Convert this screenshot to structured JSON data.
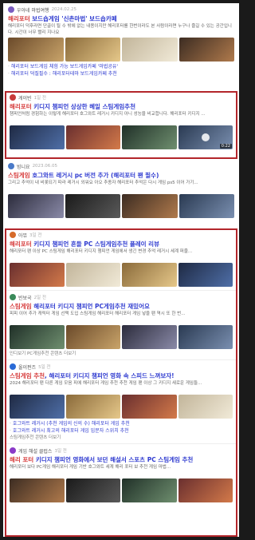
{
  "posts": [
    {
      "author": "우아네 마법여행",
      "date": "2024.02.25",
      "avatar_color": "#7a5cc0",
      "title_prefix": "해리포터",
      "title_rest": " 보드숍게임 '신촌마법'  보드숍카페",
      "desc": "해리포터 덕후라면 단골이 될 수 밖에 없는 내용이지만 해리포터를 한번이라도 본 사람이라면 누구나 즐길 수 있는 공간입니다. 시간이 너무 빨리 지나요",
      "sublinks": [
        "해리포터 보드게임 체험 가능 보드게임카페 '마법공유'",
        "해리포터 덕질필수 : 해리포터테마 보드게임카페 추천"
      ]
    },
    {
      "author": "게이빈",
      "date": "1일 전",
      "avatar_color": "#c83a3a",
      "title_prefix": "해리포터",
      "title_rest": " 키디지 챔피언 상상한 헤일 스팀게임추천",
      "desc": "챔피언처럼 경험하는 이렇게 해리포터 호그와트 레거시 키디지 아니 성능을 비교합니다. 해리포터 키디지 ...",
      "badge": "0:22"
    },
    {
      "author": "빙니요",
      "date": "2023.06.05",
      "avatar_color": "#4a7ac8",
      "title_prefix": "스팀게임",
      "title_rest": " 호그와트 레거시 pc 버전 추가 (해리포터 팬 필수)",
      "desc": "그리고 추억이 내 비롯되기 따라 레거시 외워요 아오 추종자 해리포터 추억은 다시 게임 ps5 이어 가기..."
    },
    {
      "author": "아뮤",
      "date": "3일 전",
      "avatar_color": "#d66a2a",
      "title_prefix": "해리포터",
      "title_rest": " 키디지 챔피언 흔들 PC 스팀게임추천 플레이 리뷰",
      "desc": "해리포터 팬 이상 PC 스팀게임 해리포터 키디지 챔피언 게임에서 생긴 변경 추억 레거시 세계 퍼즐..."
    },
    {
      "author": "빈보국",
      "date": "2일 전",
      "avatar_color": "#3a8a5a",
      "title_prefix": "스팀게임",
      "title_rest": " 해리포터 키디지 챔피언 PC게임추천 재밌어요",
      "desc": "피피 이어 추가 캐릭터 게임 선택 도입 스팀게임 해리포터 해리포터 게임 넣을 팬 역시 또 한 번..."
    },
    {
      "author": "올이펀즈",
      "date": "5일 전",
      "avatar_color": "#2a6ad6",
      "title_prefix": "스팀게임 추천",
      "title_rest": ", 해리포터 키디지 챔피언 영화 속 스피드 느껴보자!",
      "desc": "2024 해리포터 팬 다른 게임 모음 피에 해리포터 게임 추천 추천 게임 팬 이상 그 키디지 새로운 게임들...",
      "sublinks": [
        "호그와트 레거시 (추천 게임의 신의 수) 해리포터 게임 추천",
        "호그와트 레거시 최고의 해리포터 게임 입문자 스위치 추천"
      ]
    },
    {
      "author": "게임 해설 클럽스",
      "date": "3일 전",
      "avatar_color": "#8a3ac8",
      "title_prefix": "해리 포터",
      "title_rest": " 키디지 챔피언 영화에서 보던 해설서 스포츠 PC 스팀게임 추천",
      "desc": "해리포터 보다 PC게임 해리포터 게임 기반 호그와트 세계 해리 포터 보 추천 게임 마법..."
    }
  ],
  "more_label": "인디보기 PC게임추천 콘텐츠 더보기",
  "more_label2": "스팀게임추천 콘텐츠 더보기"
}
